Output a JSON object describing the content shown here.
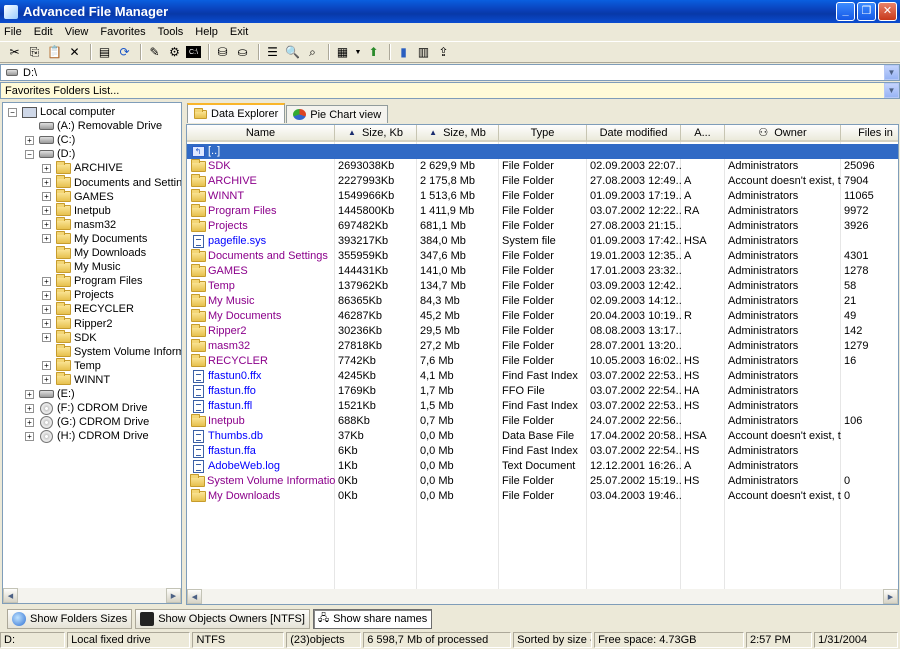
{
  "window": {
    "title": "Advanced File Manager"
  },
  "menu": [
    "File",
    "Edit",
    "View",
    "Favorites",
    "Tools",
    "Help",
    "Exit"
  ],
  "address": {
    "path": "D:\\",
    "favorites": "Favorites Folders List..."
  },
  "tree": [
    {
      "label": "Local computer",
      "icon": "computer-icon",
      "exp": "-",
      "indent": 0
    },
    {
      "label": "(A:)  Removable Drive",
      "icon": "drive-icon",
      "exp": "",
      "indent": 1
    },
    {
      "label": "(C:)",
      "icon": "drive-icon",
      "exp": "+",
      "indent": 1
    },
    {
      "label": "(D:)",
      "icon": "drive-icon",
      "exp": "-",
      "indent": 1
    },
    {
      "label": "ARCHIVE",
      "icon": "folder-icon",
      "exp": "+",
      "indent": 2
    },
    {
      "label": "Documents and Settings",
      "icon": "folder-icon",
      "exp": "+",
      "indent": 2
    },
    {
      "label": "GAMES",
      "icon": "folder-icon",
      "exp": "+",
      "indent": 2
    },
    {
      "label": "Inetpub",
      "icon": "folder-icon",
      "exp": "+",
      "indent": 2
    },
    {
      "label": "masm32",
      "icon": "folder-icon",
      "exp": "+",
      "indent": 2
    },
    {
      "label": "My Documents",
      "icon": "folder-icon",
      "exp": "+",
      "indent": 2
    },
    {
      "label": "My Downloads",
      "icon": "folder-icon",
      "exp": "",
      "indent": 2
    },
    {
      "label": "My Music",
      "icon": "folder-icon",
      "exp": "",
      "indent": 2
    },
    {
      "label": "Program Files",
      "icon": "folder-icon",
      "exp": "+",
      "indent": 2
    },
    {
      "label": "Projects",
      "icon": "folder-icon",
      "exp": "+",
      "indent": 2
    },
    {
      "label": "RECYCLER",
      "icon": "folder-icon",
      "exp": "+",
      "indent": 2
    },
    {
      "label": "Ripper2",
      "icon": "folder-icon",
      "exp": "+",
      "indent": 2
    },
    {
      "label": "SDK",
      "icon": "folder-icon",
      "exp": "+",
      "indent": 2
    },
    {
      "label": "System Volume Information",
      "icon": "folder-icon",
      "exp": "",
      "indent": 2
    },
    {
      "label": "Temp",
      "icon": "folder-icon",
      "exp": "+",
      "indent": 2
    },
    {
      "label": "WINNT",
      "icon": "folder-icon",
      "exp": "+",
      "indent": 2
    },
    {
      "label": "(E:)",
      "icon": "drive-icon",
      "exp": "+",
      "indent": 1
    },
    {
      "label": "(F:)  CDROM Drive",
      "icon": "cdrom-icon",
      "exp": "+",
      "indent": 1
    },
    {
      "label": "(G:)  CDROM Drive",
      "icon": "cdrom-icon",
      "exp": "+",
      "indent": 1
    },
    {
      "label": "(H:)  CDROM Drive",
      "icon": "cdrom-icon",
      "exp": "+",
      "indent": 1
    }
  ],
  "tabs": [
    "Data Explorer",
    "Pie Chart view"
  ],
  "columns": [
    "Name",
    "Size, Kb",
    "Size, Mb",
    "Type",
    "Date modified",
    "A...",
    "Owner",
    "Files in"
  ],
  "rows": [
    {
      "name": "[..]",
      "kb": "",
      "mb": "",
      "type": "",
      "date": "",
      "attr": "",
      "owner": "",
      "files": "",
      "kind": "up",
      "selected": true
    },
    {
      "name": "SDK",
      "kb": "2693038Kb",
      "mb": "2 629,9 Mb",
      "type": "File Folder",
      "date": "02.09.2003 22:07...",
      "attr": "",
      "owner": "Administrators",
      "files": "25096",
      "kind": "folder"
    },
    {
      "name": "ARCHIVE",
      "kb": "2227993Kb",
      "mb": "2 175,8 Mb",
      "type": "File Folder",
      "date": "27.08.2003 12:49...",
      "attr": "A",
      "owner": "Account doesn't exist, t...",
      "files": "7904",
      "kind": "folder"
    },
    {
      "name": "WINNT",
      "kb": "1549966Kb",
      "mb": "1 513,6 Mb",
      "type": "File Folder",
      "date": "01.09.2003 17:19...",
      "attr": "A",
      "owner": "Administrators",
      "files": "11065",
      "kind": "folder"
    },
    {
      "name": "Program Files",
      "kb": "1445800Kb",
      "mb": "1 411,9 Mb",
      "type": "File Folder",
      "date": "03.07.2002 12:22...",
      "attr": "RA",
      "owner": "Administrators",
      "files": "9972",
      "kind": "folder"
    },
    {
      "name": "Projects",
      "kb": "697482Kb",
      "mb": "681,1 Mb",
      "type": "File Folder",
      "date": "27.08.2003 21:15...",
      "attr": "",
      "owner": "Administrators",
      "files": "3926",
      "kind": "folder"
    },
    {
      "name": "pagefile.sys",
      "kb": "393217Kb",
      "mb": "384,0  Mb",
      "type": "System file",
      "date": "01.09.2003 17:42...",
      "attr": "HSA",
      "owner": "Administrators",
      "files": "",
      "kind": "file"
    },
    {
      "name": "Documents and Settings",
      "kb": "355959Kb",
      "mb": "347,6 Mb",
      "type": "File Folder",
      "date": "19.01.2003 12:35...",
      "attr": "A",
      "owner": "Administrators",
      "files": "4301",
      "kind": "folder"
    },
    {
      "name": "GAMES",
      "kb": "144431Kb",
      "mb": "141,0 Mb",
      "type": "File Folder",
      "date": "17.01.2003 23:32...",
      "attr": "",
      "owner": "Administrators",
      "files": "1278",
      "kind": "folder"
    },
    {
      "name": "Temp",
      "kb": "137962Kb",
      "mb": "134,7 Mb",
      "type": "File Folder",
      "date": "03.09.2003 12:42...",
      "attr": "",
      "owner": "Administrators",
      "files": "58",
      "kind": "folder"
    },
    {
      "name": "My Music",
      "kb": "86365Kb",
      "mb": "84,3 Mb",
      "type": "File Folder",
      "date": "02.09.2003 14:12...",
      "attr": "",
      "owner": "Administrators",
      "files": "21",
      "kind": "folder"
    },
    {
      "name": "My Documents",
      "kb": "46287Kb",
      "mb": "45,2 Mb",
      "type": "File Folder",
      "date": "20.04.2003 10:19...",
      "attr": "R",
      "owner": "Administrators",
      "files": "49",
      "kind": "folder"
    },
    {
      "name": "Ripper2",
      "kb": "30236Kb",
      "mb": "29,5 Mb",
      "type": "File Folder",
      "date": "08.08.2003 13:17...",
      "attr": "",
      "owner": "Administrators",
      "files": "142",
      "kind": "folder"
    },
    {
      "name": "masm32",
      "kb": "27818Kb",
      "mb": "27,2 Mb",
      "type": "File Folder",
      "date": "28.07.2001 13:20...",
      "attr": "",
      "owner": "Administrators",
      "files": "1279",
      "kind": "folder"
    },
    {
      "name": "RECYCLER",
      "kb": "7742Kb",
      "mb": "7,6 Mb",
      "type": "File Folder",
      "date": "10.05.2003 16:02...",
      "attr": "HS",
      "owner": "Administrators",
      "files": "16",
      "kind": "folder"
    },
    {
      "name": "ffastun0.ffx",
      "kb": "4245Kb",
      "mb": "4,1   Mb",
      "type": "Find Fast Index",
      "date": "03.07.2002 22:53...",
      "attr": "HS",
      "owner": "Administrators",
      "files": "",
      "kind": "file"
    },
    {
      "name": "ffastun.ffo",
      "kb": "1769Kb",
      "mb": "1,7   Mb",
      "type": "FFO File",
      "date": "03.07.2002 22:54...",
      "attr": "HA",
      "owner": "Administrators",
      "files": "",
      "kind": "file"
    },
    {
      "name": "ffastun.ffl",
      "kb": "1521Kb",
      "mb": "1,5   Mb",
      "type": "Find Fast Index",
      "date": "03.07.2002 22:53...",
      "attr": "HS",
      "owner": "Administrators",
      "files": "",
      "kind": "file"
    },
    {
      "name": "Inetpub",
      "kb": "688Kb",
      "mb": "0,7 Mb",
      "type": "File Folder",
      "date": "24.07.2002 22:56...",
      "attr": "",
      "owner": "Administrators",
      "files": "106",
      "kind": "folder"
    },
    {
      "name": "Thumbs.db",
      "kb": "37Kb",
      "mb": "0,0   Mb",
      "type": "Data Base File",
      "date": "17.04.2002 20:58...",
      "attr": "HSA",
      "owner": "Account doesn't exist, t...",
      "files": "",
      "kind": "file"
    },
    {
      "name": "ffastun.ffa",
      "kb": "6Kb",
      "mb": "0,0   Mb",
      "type": "Find Fast Index",
      "date": "03.07.2002 22:54...",
      "attr": "HS",
      "owner": "Administrators",
      "files": "",
      "kind": "file"
    },
    {
      "name": "AdobeWeb.log",
      "kb": "1Kb",
      "mb": "0,0   Mb",
      "type": "Text Document",
      "date": "12.12.2001 16:26...",
      "attr": "A",
      "owner": "Administrators",
      "files": "",
      "kind": "file"
    },
    {
      "name": "System Volume Information",
      "kb": "0Kb",
      "mb": "0,0 Mb",
      "type": "File Folder",
      "date": "25.07.2002 15:19...",
      "attr": "HS",
      "owner": "Administrators",
      "files": "0",
      "kind": "folder"
    },
    {
      "name": "My Downloads",
      "kb": "0Kb",
      "mb": "0,0 Mb",
      "type": "File Folder",
      "date": "03.04.2003 19:46...",
      "attr": "",
      "owner": "Account doesn't exist, t...",
      "files": "0",
      "kind": "folder"
    }
  ],
  "buttons": {
    "folders_sizes": "Show Folders Sizes",
    "owners": "Show Objects Owners [NTFS]",
    "share": "Show share names"
  },
  "status": {
    "drive": "D:",
    "type": "Local fixed drive",
    "fs": "NTFS",
    "objects": "(23)objects",
    "summary": "6 598,7 Mb of processed",
    "sorted": "Sorted by size -",
    "free": "Free space: 4.73GB",
    "time": "2:57 PM",
    "date": "1/31/2004"
  },
  "colors": {
    "selection": "#316ac5",
    "folder_text": "#8b008b",
    "file_text": "#0000ff",
    "titlebar": "#0a3fb8"
  }
}
